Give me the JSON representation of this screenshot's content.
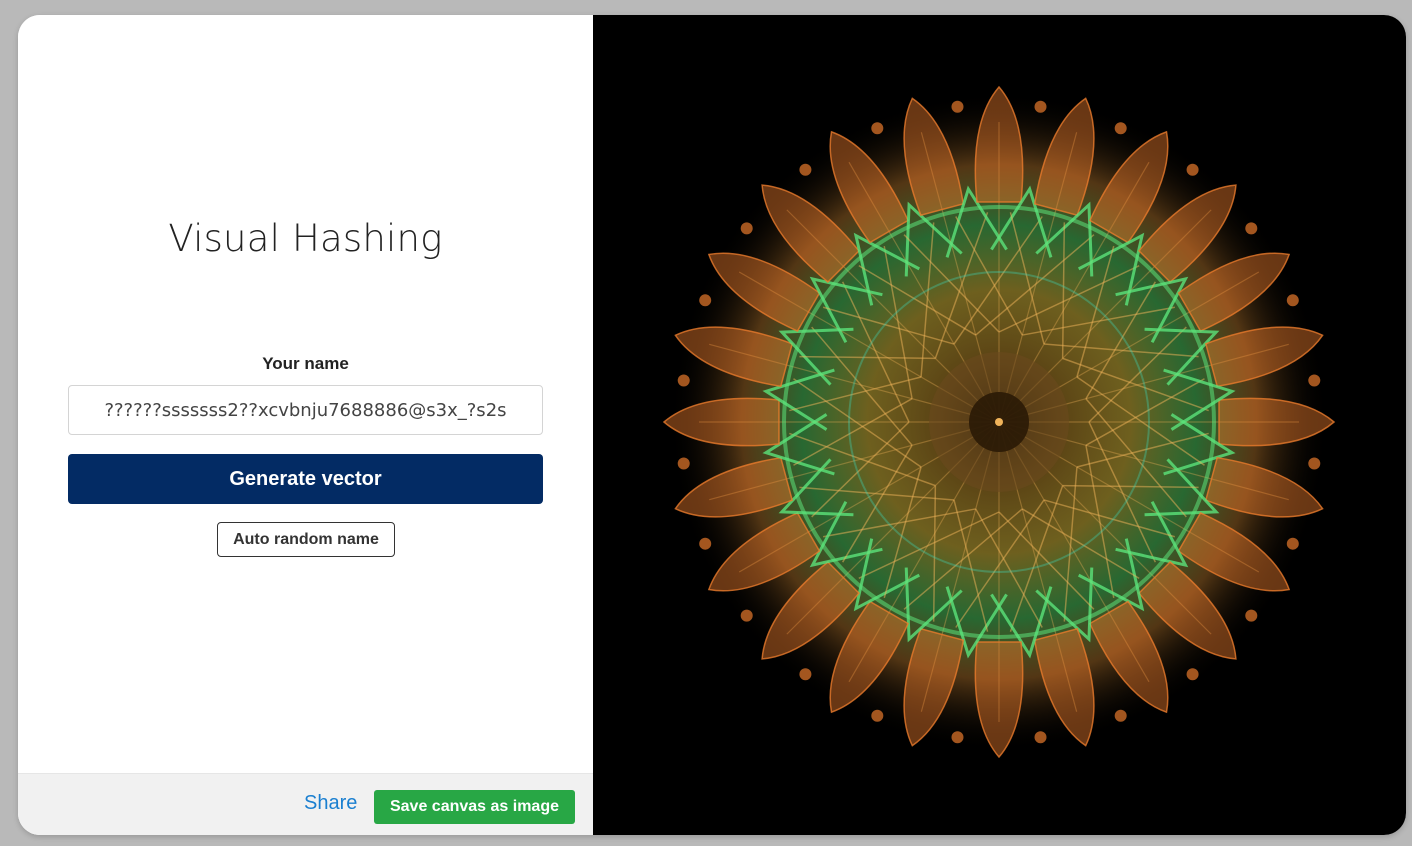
{
  "title": "Visual Hashing",
  "form": {
    "label": "Your name",
    "input_value": "??????sssssss2??xcvbnju7688886@s3x_?s2s",
    "generate_label": "Generate vector",
    "random_label": "Auto random name"
  },
  "footer": {
    "share_label": "Share",
    "save_label": "Save canvas as image"
  },
  "canvas": {
    "description_icon": "mandala-pattern",
    "colors": {
      "background": "#000000",
      "orange": "#e87a2c",
      "green": "#5be37a",
      "cyan": "#3fd6b8",
      "amber": "#f0b35a",
      "brown": "#6b4a1e"
    }
  },
  "colors": {
    "primary": "#032b64",
    "success": "#28a745",
    "link": "#1a7fd0"
  }
}
